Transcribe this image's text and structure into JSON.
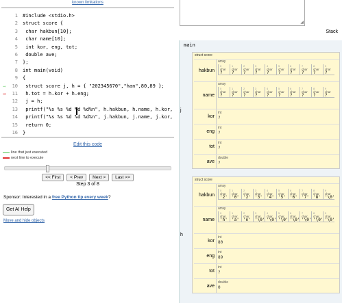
{
  "known_limitations": "known limitations",
  "code": {
    "lines": [
      {
        "n": "1",
        "text": "#include <stdio.h>",
        "marker": ""
      },
      {
        "n": "2",
        "text": "struct score {",
        "marker": ""
      },
      {
        "n": "3",
        "text": " char hakbun[10];",
        "marker": ""
      },
      {
        "n": "4",
        "text": " char name[10];",
        "marker": ""
      },
      {
        "n": "5",
        "text": " int kor, eng, tot;",
        "marker": ""
      },
      {
        "n": "6",
        "text": " double ave;",
        "marker": ""
      },
      {
        "n": "7",
        "text": "};",
        "marker": ""
      },
      {
        "n": "8",
        "text": "int main(void)",
        "marker": ""
      },
      {
        "n": "9",
        "text": "{",
        "marker": ""
      },
      {
        "n": "10",
        "text": " struct score j, h = { \"202345670\",\"han\",80,89 };",
        "marker": "prev"
      },
      {
        "n": "11",
        "text": " h.tot = h.kor + h.eng;",
        "marker": "next"
      },
      {
        "n": "12",
        "text": " j = h;",
        "marker": ""
      },
      {
        "n": "13",
        "text": " printf(\"%s %s %d %d %d%n\", h.hakbun, h.name, h.kor, h.e",
        "marker": ""
      },
      {
        "n": "14",
        "text": " printf(\"%s %s %d %d %d%n\", j.hakbun, j.name, j.kor, j.e",
        "marker": ""
      },
      {
        "n": "15",
        "text": " return 0;",
        "marker": ""
      },
      {
        "n": "16",
        "text": "}",
        "marker": ""
      }
    ]
  },
  "edit_code": "Edit this code",
  "legend": {
    "prev": "line that just executed",
    "next": "next line to execute",
    "prev_color": "#a0e0a0",
    "next_color": "#e03030"
  },
  "slider": {
    "position": 0.25
  },
  "nav": {
    "first": "<< First",
    "prev": "< Prev",
    "next": "Next >",
    "last": "Last >>"
  },
  "step_text": "Step 3 of 8",
  "sponsor": {
    "prefix": "Sponsor: Interested in a ",
    "link": "free Python tip every week",
    "suffix": "?"
  },
  "ai_help": "Get AI Help",
  "move_hide": "Move and hide objects",
  "stack_label": "Stack",
  "frame": {
    "name": "main",
    "vars": [
      {
        "name": "j",
        "struct_label": "struct score",
        "fields": [
          {
            "key": "hakbun",
            "type": "array",
            "cells": [
              {
                "i": "0",
                "t": "char",
                "v": "?"
              },
              {
                "i": "1",
                "t": "char",
                "v": "?"
              },
              {
                "i": "2",
                "t": "char",
                "v": "?"
              },
              {
                "i": "3",
                "t": "char",
                "v": "?"
              },
              {
                "i": "4",
                "t": "char",
                "v": "?"
              },
              {
                "i": "5",
                "t": "char",
                "v": "?"
              },
              {
                "i": "6",
                "t": "char",
                "v": "?"
              },
              {
                "i": "7",
                "t": "char",
                "v": "?"
              },
              {
                "i": "8",
                "t": "char",
                "v": "?"
              },
              {
                "i": "9",
                "t": "char",
                "v": "?"
              }
            ]
          },
          {
            "key": "name",
            "type": "array",
            "cells": [
              {
                "i": "0",
                "t": "char",
                "v": "?"
              },
              {
                "i": "1",
                "t": "char",
                "v": "?"
              },
              {
                "i": "2",
                "t": "char",
                "v": "?"
              },
              {
                "i": "3",
                "t": "char",
                "v": "?"
              },
              {
                "i": "4",
                "t": "char",
                "v": "?"
              },
              {
                "i": "5",
                "t": "char",
                "v": "?"
              },
              {
                "i": "6",
                "t": "char",
                "v": "?"
              },
              {
                "i": "7",
                "t": "char",
                "v": "?"
              },
              {
                "i": "8",
                "t": "char",
                "v": "?"
              },
              {
                "i": "9",
                "t": "char",
                "v": "?"
              }
            ]
          },
          {
            "key": "kor",
            "type": "int",
            "value": "?"
          },
          {
            "key": "eng",
            "type": "int",
            "value": "?"
          },
          {
            "key": "tot",
            "type": "int",
            "value": "?"
          },
          {
            "key": "ave",
            "type": "double",
            "value": "?"
          }
        ]
      },
      {
        "name": "h",
        "struct_label": "struct score",
        "fields": [
          {
            "key": "hakbun",
            "type": "array",
            "cells": [
              {
                "i": "0",
                "t": "char",
                "v": "'2'"
              },
              {
                "i": "1",
                "t": "char",
                "v": "'0'"
              },
              {
                "i": "2",
                "t": "char",
                "v": "'2'"
              },
              {
                "i": "3",
                "t": "char",
                "v": "'3'"
              },
              {
                "i": "4",
                "t": "char",
                "v": "'4'"
              },
              {
                "i": "5",
                "t": "char",
                "v": "'5'"
              },
              {
                "i": "6",
                "t": "char",
                "v": "'6'"
              },
              {
                "i": "7",
                "t": "char",
                "v": "'7'"
              },
              {
                "i": "8",
                "t": "char",
                "v": "'8'"
              },
              {
                "i": "9",
                "t": "char",
                "v": "'\\0'"
              }
            ]
          },
          {
            "key": "name",
            "type": "array",
            "cells": [
              {
                "i": "0",
                "t": "char",
                "v": "'h'"
              },
              {
                "i": "1",
                "t": "char",
                "v": "'a'"
              },
              {
                "i": "2",
                "t": "char",
                "v": "'n'"
              },
              {
                "i": "3",
                "t": "char",
                "v": "'\\0'"
              },
              {
                "i": "4",
                "t": "char",
                "v": "'\\0'"
              },
              {
                "i": "5",
                "t": "char",
                "v": "'\\0'"
              },
              {
                "i": "6",
                "t": "char",
                "v": "'\\0'"
              },
              {
                "i": "7",
                "t": "char",
                "v": "'\\0'"
              },
              {
                "i": "8",
                "t": "char",
                "v": "'\\0'"
              },
              {
                "i": "9",
                "t": "char",
                "v": "'\\0'"
              }
            ]
          },
          {
            "key": "kor",
            "type": "int",
            "value": "80"
          },
          {
            "key": "eng",
            "type": "int",
            "value": "89"
          },
          {
            "key": "tot",
            "type": "int",
            "value": "?"
          },
          {
            "key": "ave",
            "type": "double",
            "value": "0"
          }
        ]
      }
    ]
  }
}
